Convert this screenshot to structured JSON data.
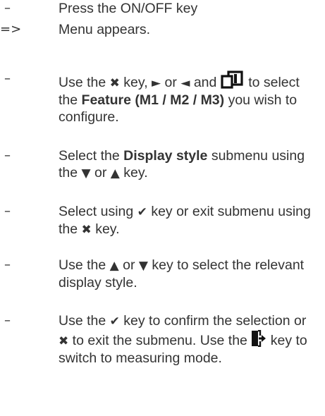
{
  "steps": [
    {
      "marker": "–",
      "text": "Press the ON/OFF key"
    },
    {
      "marker": "=>",
      "text": "Menu appears."
    },
    {
      "marker": "–",
      "parts": {
        "a": "Use the",
        "key_x": "✖",
        "b": "key,",
        "key_right": "►",
        "c": "or",
        "key_left": "◄",
        "d": "and",
        "e": "to select the",
        "bold": "Feature (M1 / M2 / M3)",
        "f": "you wish to configure."
      }
    },
    {
      "marker": "–",
      "parts": {
        "a": "Select the",
        "bold": "Display style",
        "b": "submenu using the",
        "key_down": "▼",
        "c": "or",
        "key_up": "▲",
        "d": "key."
      }
    },
    {
      "marker": "–",
      "parts": {
        "a": "Select using",
        "key_check": "✔",
        "b": "key or exit submenu using the",
        "key_x": "✖",
        "c": "key."
      }
    },
    {
      "marker": "–",
      "parts": {
        "a": "Use the",
        "key_up": "▲",
        "b": "or",
        "key_down": "▼",
        "c": "key to select the relevant display style."
      }
    },
    {
      "marker": "–",
      "parts": {
        "a": "Use the",
        "key_check": "✔",
        "b": "key to confirm the selection or",
        "key_x": "✖",
        "c": "to exit the submenu. Use the",
        "d": "key to switch to measuring mode."
      }
    }
  ],
  "icons": {
    "feature_key": "copy-pages-icon",
    "exit_key": "exit-door-icon",
    "text_color": "#333333"
  }
}
